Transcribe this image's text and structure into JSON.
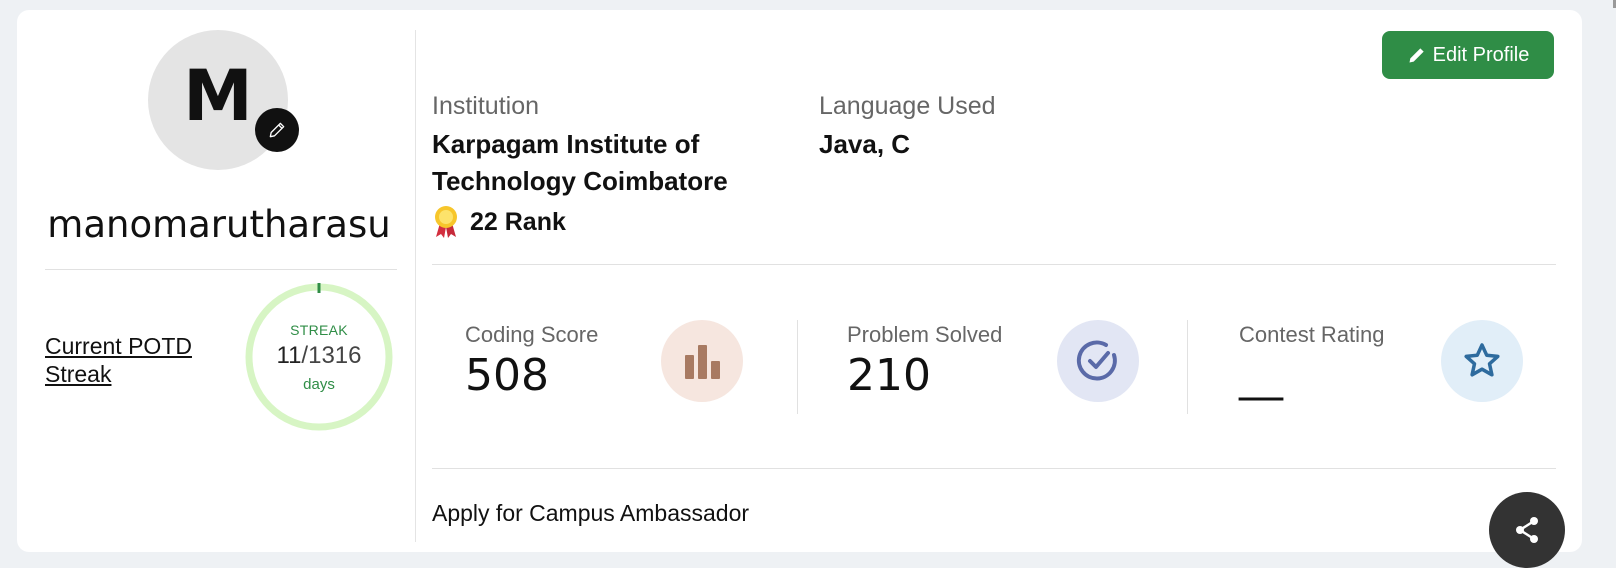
{
  "profile": {
    "avatar_letter": "M",
    "username": "manomarutharasu"
  },
  "streak": {
    "link_label": "Current POTD Streak",
    "label": "STREAK",
    "current": "11",
    "total": "/1316",
    "unit": "days"
  },
  "details": {
    "institution_label": "Institution",
    "institution_value": "Karpagam Institute of Technology Coimbatore",
    "language_label": "Language Used",
    "language_value": "Java, C",
    "rank_text": "22 Rank"
  },
  "actions": {
    "edit_profile_label": "Edit Profile",
    "campus_ambassador_label": "Apply for Campus Ambassador"
  },
  "stats": [
    {
      "label": "Coding Score",
      "value": "508",
      "icon": "bar-chart-icon",
      "icon_bg": "#f6e6df",
      "icon_color": "#a87a62"
    },
    {
      "label": "Problem Solved",
      "value": "210",
      "icon": "check-circle-icon",
      "icon_bg": "#e2e6f4",
      "icon_color": "#5a6aa8"
    },
    {
      "label": "Contest Rating",
      "value": "__",
      "icon": "star-icon",
      "icon_bg": "#e1eef8",
      "icon_color": "#2e6b9e"
    }
  ],
  "colors": {
    "accent_green": "#2f8d46",
    "streak_ring": "#d7f5c4"
  }
}
